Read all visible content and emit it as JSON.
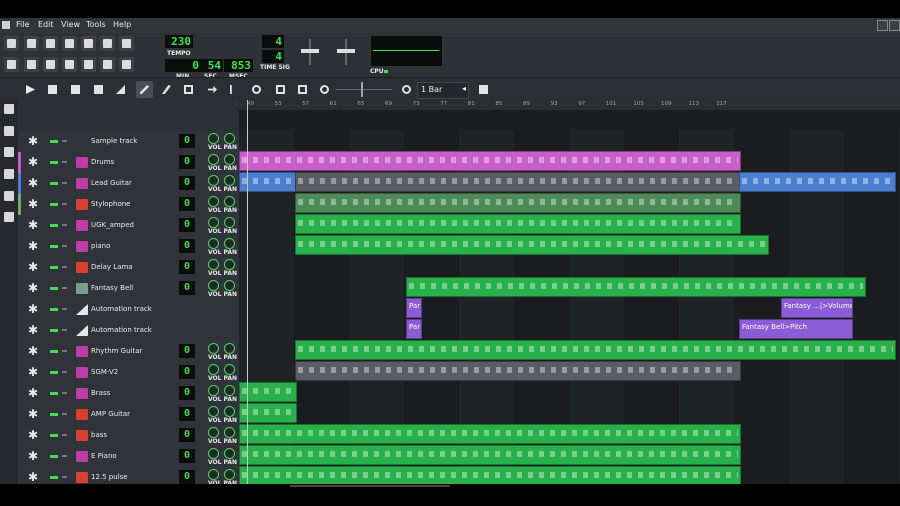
{
  "menu": [
    "File",
    "Edit",
    "View",
    "Tools",
    "Help"
  ],
  "transport": {
    "tempo": "230",
    "tempo_label": "TEMPO",
    "min": "0",
    "min_label": "MIN",
    "sec": "54",
    "sec_label": "SEC",
    "msec": "853",
    "msec_label": "MSEC",
    "timesig_num": "4",
    "timesig_den": "4",
    "timesig_label": "TIME SIG",
    "cpu_label": "CPU"
  },
  "editor_toolbar": {
    "zoom_value": "1 Bar"
  },
  "ruler": [
    "49",
    "53",
    "57",
    "61",
    "65",
    "69",
    "73",
    "77",
    "81",
    "85",
    "89",
    "93",
    "97",
    "101",
    "105",
    "109",
    "113",
    "117"
  ],
  "vol_pan_label": "VOL PAN",
  "colors": {
    "lcd_green": "#32e84a",
    "pink_clip": "#c85ec8",
    "blue_clip": "#4a7fd0",
    "gray_clip": "#5a5d63",
    "green_clip": "#28b04a",
    "purple_clip": "#8a5cd6"
  },
  "tracks": [
    {
      "name": "Sample track",
      "icon": "sample-icon",
      "vol": "0"
    },
    {
      "name": "Drums",
      "icon": "piano-icon",
      "vol": "0"
    },
    {
      "name": "Lead Guitar",
      "icon": "piano-icon",
      "vol": "0"
    },
    {
      "name": "Stylophone",
      "icon": "stylophone-icon",
      "vol": "0"
    },
    {
      "name": "UGK_amped",
      "icon": "piano-icon",
      "vol": "0"
    },
    {
      "name": "piano",
      "icon": "piano-icon",
      "vol": "0"
    },
    {
      "name": "Delay Lama",
      "icon": "delay-lama-icon",
      "vol": "0"
    },
    {
      "name": "Fantasy Bell",
      "icon": "bell-icon",
      "vol": "0"
    },
    {
      "name": "Automation track",
      "icon": "automation-icon",
      "vol": ""
    },
    {
      "name": "Automation track",
      "icon": "automation-icon",
      "vol": ""
    },
    {
      "name": "Rhythm Guitar",
      "icon": "piano-icon",
      "vol": "0"
    },
    {
      "name": "SGM-V2",
      "icon": "piano-icon",
      "vol": "0"
    },
    {
      "name": "Brass",
      "icon": "piano-icon",
      "vol": "0"
    },
    {
      "name": "AMP Guitar",
      "icon": "stylophone-icon",
      "vol": "0"
    },
    {
      "name": "bass",
      "icon": "stylophone-icon",
      "vol": "0"
    },
    {
      "name": "E Piano",
      "icon": "piano-icon",
      "vol": "0"
    },
    {
      "name": "12.5 pulse",
      "icon": "stylophone-icon",
      "vol": "0"
    }
  ],
  "automation_clips": [
    {
      "label": "Par"
    },
    {
      "label": "Fantasy ...|>Volume"
    },
    {
      "label": "Par"
    },
    {
      "label": "Fantasy Bell>Pitch"
    }
  ]
}
